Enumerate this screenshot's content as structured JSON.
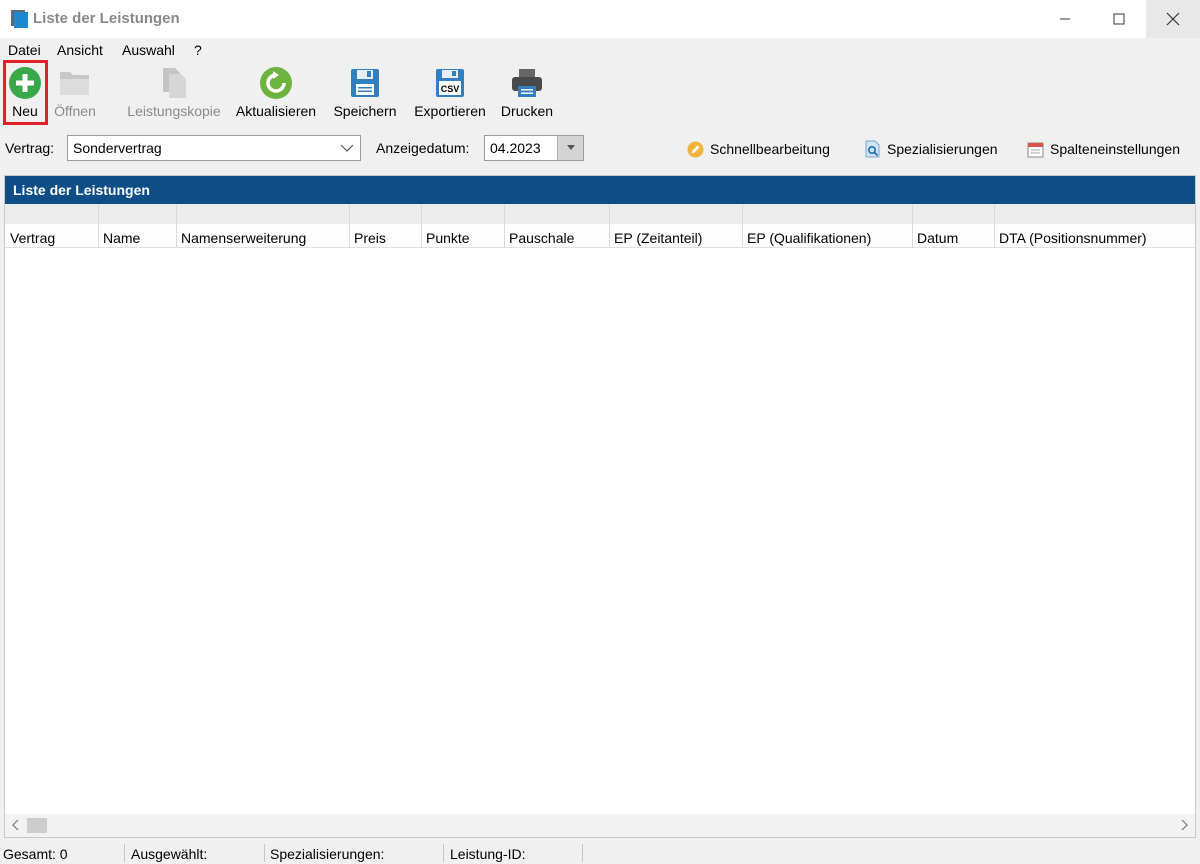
{
  "window": {
    "title": "Liste der Leistungen"
  },
  "menu": [
    {
      "label": "Datei"
    },
    {
      "label": "Ansicht"
    },
    {
      "label": "Auswahl"
    },
    {
      "label": "?"
    }
  ],
  "toolbar": {
    "new": {
      "label": "Neu",
      "icon": "plus-circle-icon",
      "enabled": true,
      "highlighted": true
    },
    "open": {
      "label": "Öffnen",
      "icon": "folder-icon",
      "enabled": false
    },
    "copy": {
      "label": "Leistungskopie",
      "icon": "copy-icon",
      "enabled": false
    },
    "refresh": {
      "label": "Aktualisieren",
      "icon": "refresh-icon",
      "enabled": true
    },
    "save": {
      "label": "Speichern",
      "icon": "floppy-icon",
      "enabled": true
    },
    "export": {
      "label": "Exportieren",
      "icon": "csv-icon",
      "icon_text": "CSV",
      "enabled": true
    },
    "print": {
      "label": "Drucken",
      "icon": "printer-icon",
      "enabled": true
    }
  },
  "filters": {
    "contract_label": "Vertrag:",
    "contract_value": "Sondervertrag",
    "date_label": "Anzeigedatum:",
    "date_value": "04.2023",
    "quick_edit": "Schnellbearbeitung",
    "specializations": "Spezialisierungen",
    "column_settings": "Spalteneinstellungen"
  },
  "panel": {
    "title": "Liste der Leistungen",
    "columns": [
      "Vertrag",
      "Name",
      "Namenserweiterung",
      "Preis",
      "Punkte",
      "Pauschale",
      "EP (Zeitanteil)",
      "EP (Qualifikationen)",
      "Datum",
      "DTA (Positionsnummer)"
    ],
    "rows": []
  },
  "status": {
    "total": "Gesamt: 0",
    "selected": "Ausgewählt:",
    "specializations": "Spezialisierungen:",
    "service_id": "Leistung-ID:"
  },
  "colors": {
    "header_blue": "#0e4d86",
    "highlight_red": "#e2202a",
    "new_green": "#3aa84a",
    "refresh_green": "#6db33f",
    "floppy_blue": "#2f7fc1"
  }
}
